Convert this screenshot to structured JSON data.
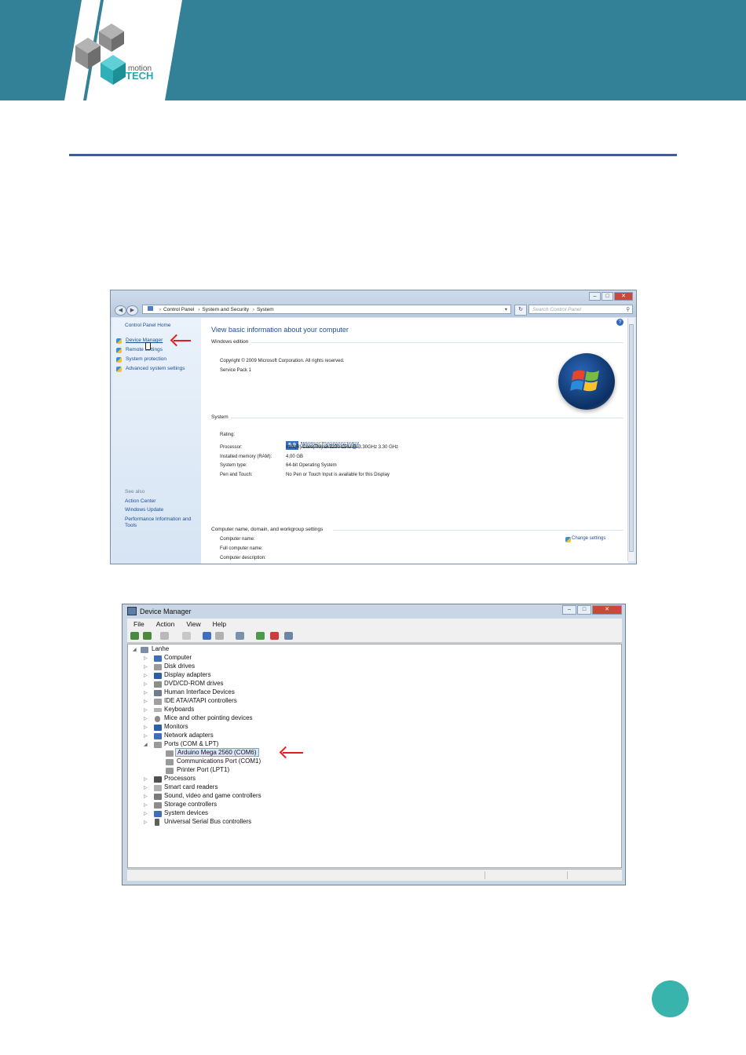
{
  "logo": {
    "motion": "motion",
    "tech": "TECH"
  },
  "system_window": {
    "address": [
      "Control Panel",
      "System and Security",
      "System"
    ],
    "search_placeholder": "Search Control Panel",
    "sidebar": {
      "home": "Control Panel Home",
      "tasks": [
        "Device Manager",
        "Remote settings",
        "System protection",
        "Advanced system settings"
      ],
      "see_also_label": "See also",
      "see_also": [
        "Action Center",
        "Windows Update",
        "Performance Information and",
        "Tools"
      ]
    },
    "title": "View basic information about your computer",
    "windows_edition": {
      "label": "Windows edition",
      "copyright": "Copyright © 2009 Microsoft Corporation.  All rights reserved.",
      "service_pack": "Service Pack 1"
    },
    "system": {
      "label": "System",
      "rows": [
        {
          "label": "Rating:",
          "value": ""
        },
        {
          "label": "Processor:",
          "value": "Intel(R) Core(TM) i3-3220 CPU @ 3.30GHz   3.30 GHz"
        },
        {
          "label": "Installed memory (RAM):",
          "value": "4,00 GB"
        },
        {
          "label": "System type:",
          "value": "64-bit Operating System"
        },
        {
          "label": "Pen and Touch:",
          "value": "No Pen or Touch Input is available for this Display"
        }
      ],
      "rating_score": "5,9",
      "rating_link": "Windows Experience Index"
    },
    "computer_name": {
      "label": "Computer name, domain, and workgroup settings",
      "rows": [
        "Computer name:",
        "Full computer name:",
        "Computer description:"
      ],
      "change_settings": "Change settings"
    }
  },
  "device_manager": {
    "title": "Device Manager",
    "menu": [
      "File",
      "Action",
      "View",
      "Help"
    ],
    "root": "Lanhe",
    "categories": [
      "Computer",
      "Disk drives",
      "Display adapters",
      "DVD/CD-ROM drives",
      "Human Interface Devices",
      "IDE ATA/ATAPI controllers",
      "Keyboards",
      "Mice and other pointing devices",
      "Monitors",
      "Network adapters",
      "Ports (COM & LPT)"
    ],
    "ports": [
      "Arduino Mega 2560 (COM6)",
      "Communications Port (COM1)",
      "Printer Port (LPT1)"
    ],
    "categories_after": [
      "Processors",
      "Smart card readers",
      "Sound, video and game controllers",
      "Storage controllers",
      "System devices",
      "Universal Serial Bus controllers"
    ]
  },
  "colors": {
    "header": "#338196",
    "rule": "#3b5f96",
    "page_dot": "#39b4ac",
    "arrow": "#e02020"
  }
}
